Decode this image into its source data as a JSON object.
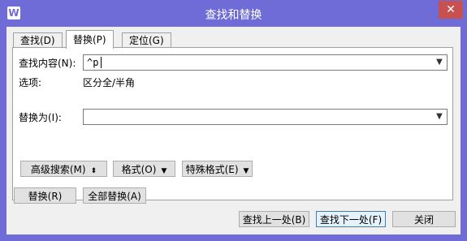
{
  "window": {
    "title": "查找和替换",
    "close_glyph": "✕"
  },
  "tabs": [
    {
      "label": "查找(D)"
    },
    {
      "label": "替换(P)"
    },
    {
      "label": "定位(G)"
    }
  ],
  "find": {
    "label": "查找内容(N):",
    "value": "^p"
  },
  "options": {
    "label": "选项:",
    "value": "区分全/半角"
  },
  "replace": {
    "label": "替换为(I):",
    "value": ""
  },
  "toolbar": {
    "advanced_search": "高级搜索(M)",
    "format": "格式(O)",
    "special_format": "特殊格式(E)"
  },
  "actions": {
    "replace": "替换(R)",
    "replace_all": "全部替换(A)",
    "find_prev": "查找上一处(B)",
    "find_next": "查找下一处(F)",
    "close": "关闭"
  },
  "icons": {
    "app": "wps-writer-icon",
    "arrow_down": "▼",
    "double_arrow": "⬍"
  },
  "colors": {
    "titlebar": "#6f6cd7",
    "close_button": "#c75050"
  }
}
